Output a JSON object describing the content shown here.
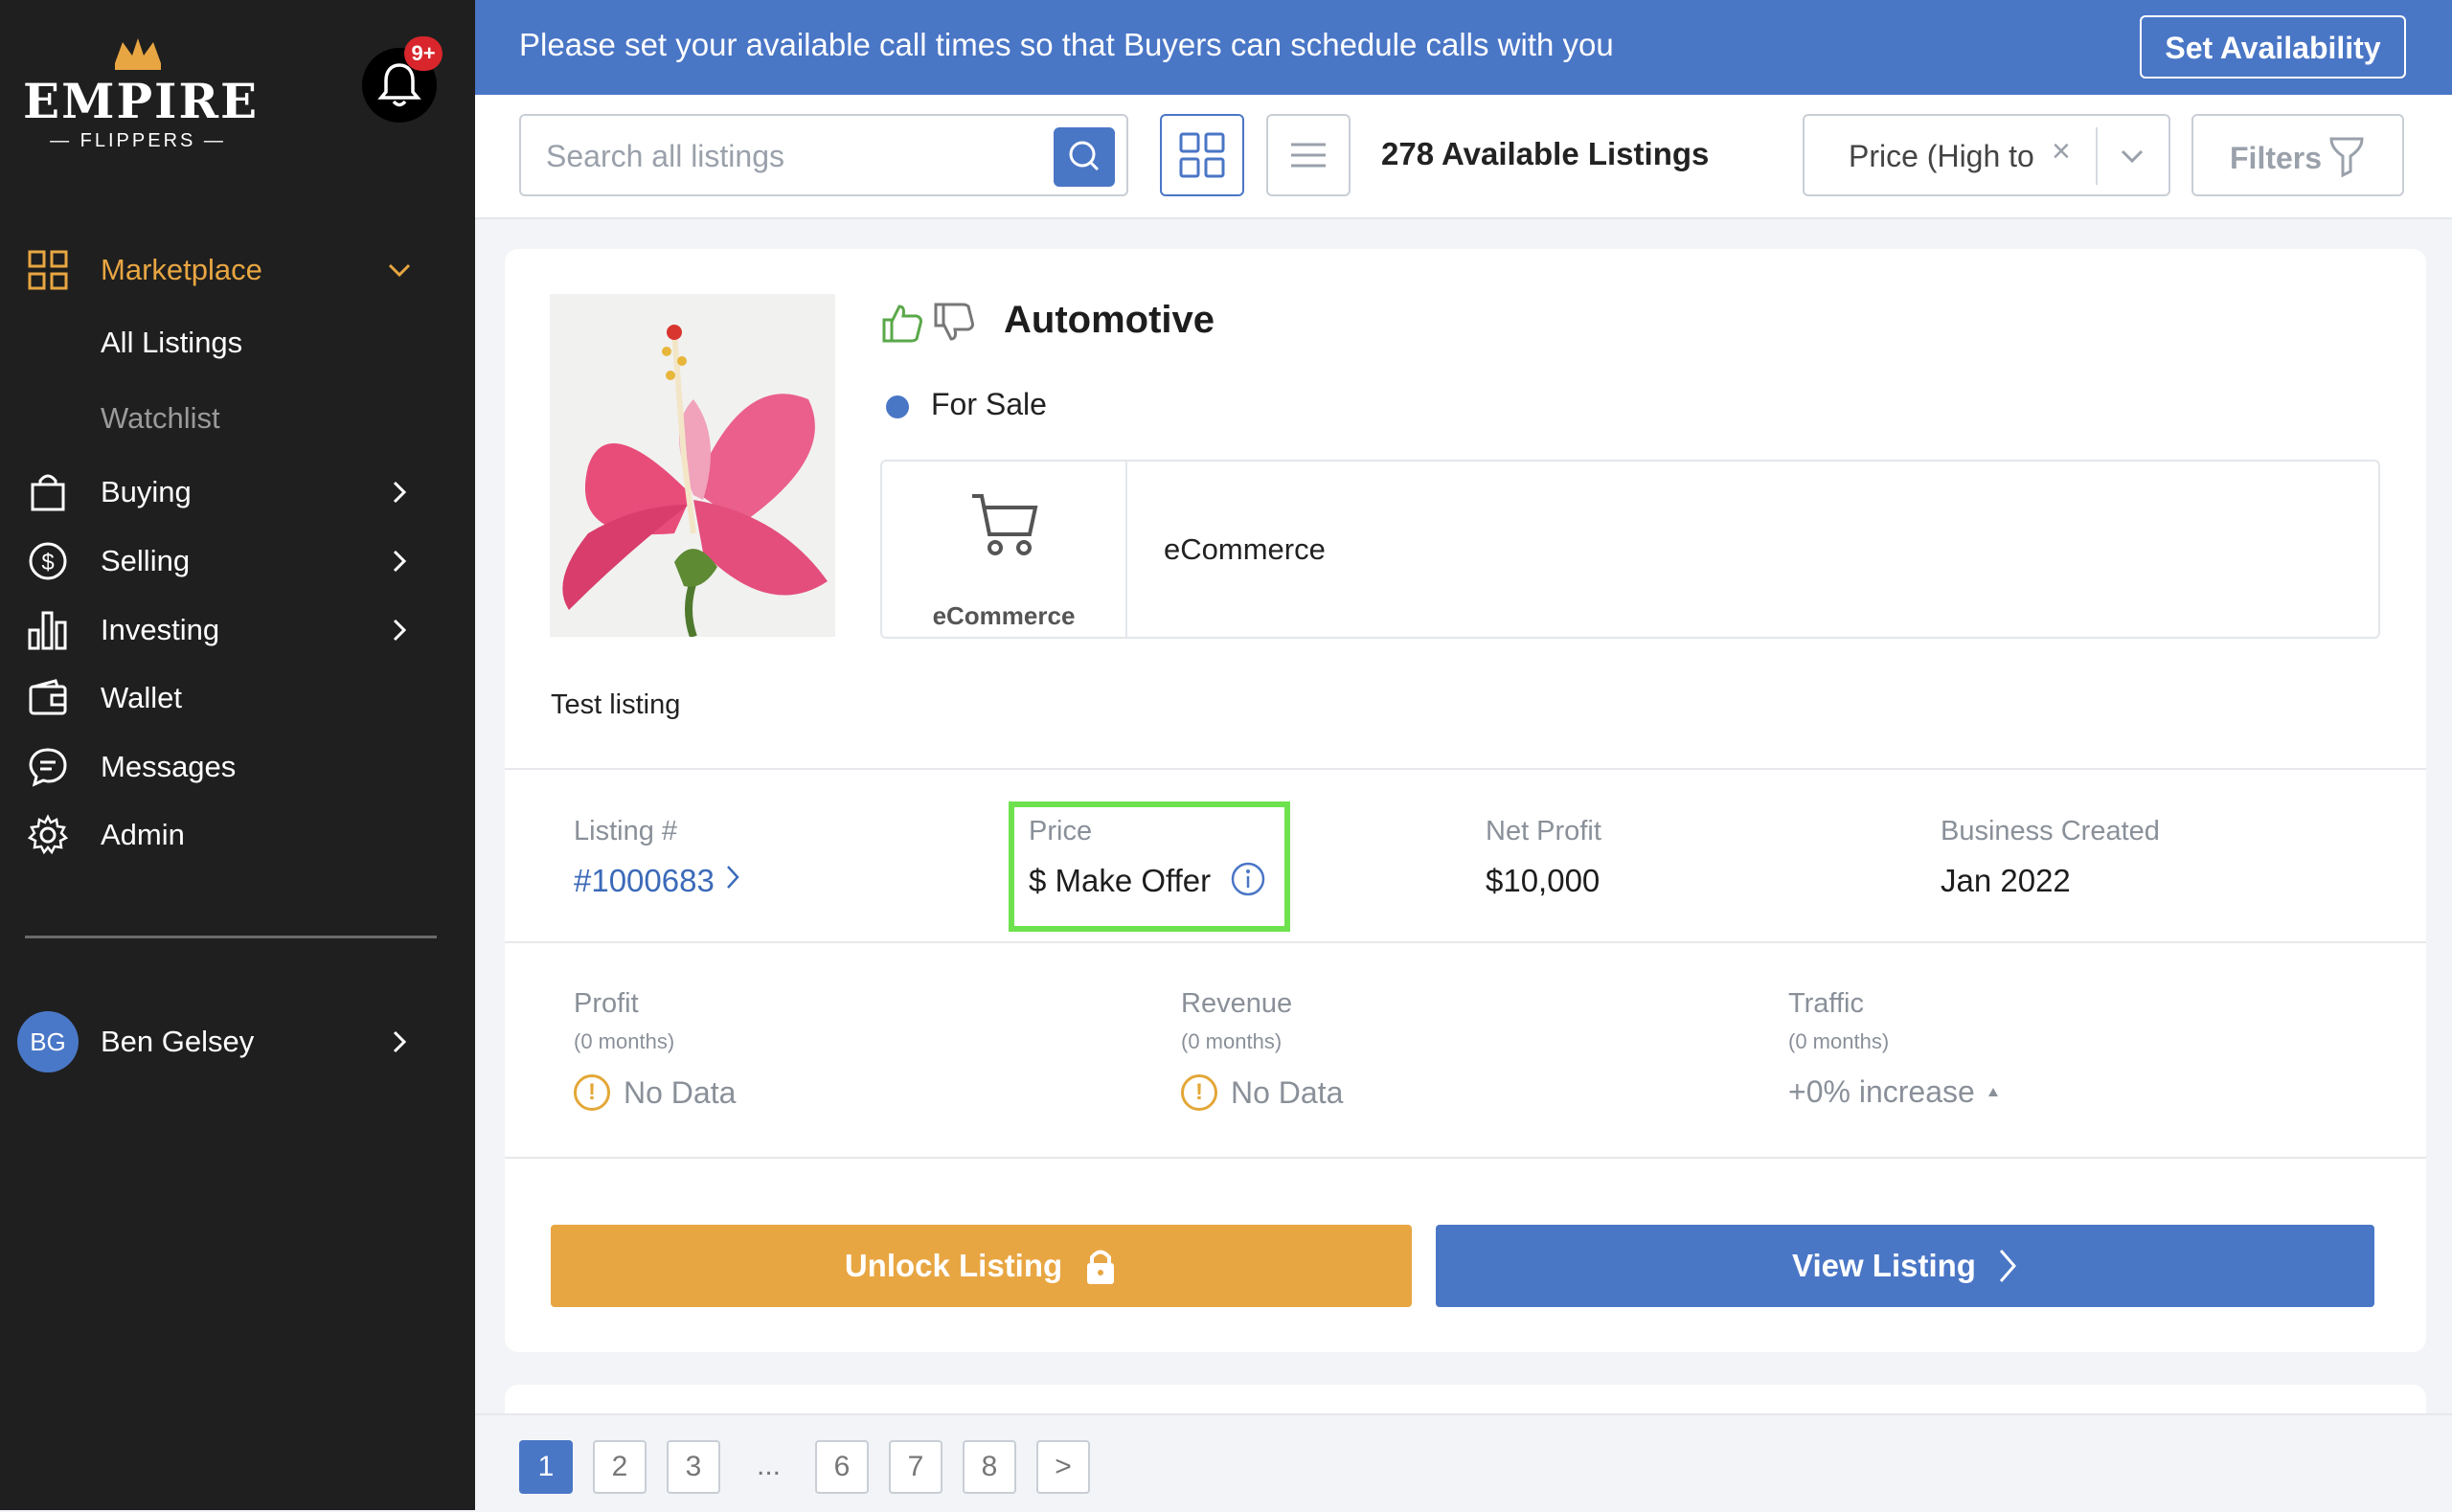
{
  "brand": {
    "logo_text": "EMPIRE",
    "logo_sub": "— FLIPPERS —"
  },
  "notifications": {
    "badge": "9+"
  },
  "sidebar": {
    "items": [
      {
        "label": "Marketplace",
        "icon": "grid-icon",
        "active": true,
        "color": "#e8a642"
      },
      {
        "label": "All Listings"
      },
      {
        "label": "Watchlist"
      },
      {
        "label": "Buying",
        "icon": "shopping-bag-icon"
      },
      {
        "label": "Selling",
        "icon": "dollar-circle-icon"
      },
      {
        "label": "Investing",
        "icon": "bar-chart-icon"
      },
      {
        "label": "Wallet",
        "icon": "wallet-icon"
      },
      {
        "label": "Messages",
        "icon": "chat-icon"
      },
      {
        "label": "Admin",
        "icon": "gear-icon"
      }
    ],
    "user": {
      "initials": "BG",
      "name": "Ben Gelsey"
    }
  },
  "banner": {
    "text": "Please set your available call times so that Buyers can schedule calls with you",
    "button": "Set Availability"
  },
  "toolbar": {
    "search_placeholder": "Search all listings",
    "listing_count": "278 Available Listings",
    "sort_value": "Price (High to",
    "sort_clear": "×",
    "filters_label": "Filters"
  },
  "listing": {
    "niche": "Automotive",
    "status": "For Sale",
    "monetization_icon_label": "eCommerce",
    "monetization_text": "eCommerce",
    "description": "Test listing",
    "stats": {
      "listing_label": "Listing #",
      "listing_value": "#1000683",
      "price_label": "Price",
      "price_value": "$ Make Offer",
      "net_profit_label": "Net Profit",
      "net_profit_value": "$10,000",
      "created_label": "Business Created",
      "created_value": "Jan 2022"
    },
    "metrics": [
      {
        "label": "Profit",
        "sub": "(0 months)",
        "value": "No Data"
      },
      {
        "label": "Revenue",
        "sub": "(0 months)",
        "value": "No Data"
      },
      {
        "label": "Traffic",
        "sub": "(0 months)",
        "value": "+0% increase"
      }
    ],
    "unlock_label": "Unlock Listing",
    "view_label": "View Listing"
  },
  "pagination": {
    "pages": [
      "1",
      "2",
      "3",
      "6",
      "7",
      "8"
    ],
    "ellipsis": "...",
    "next": ">",
    "current": "1"
  },
  "colors": {
    "accent_blue": "#4a76c6",
    "accent_orange": "#e8a642",
    "sidebar_bg": "#1f1f1f",
    "highlight_green": "#6ee24e"
  }
}
